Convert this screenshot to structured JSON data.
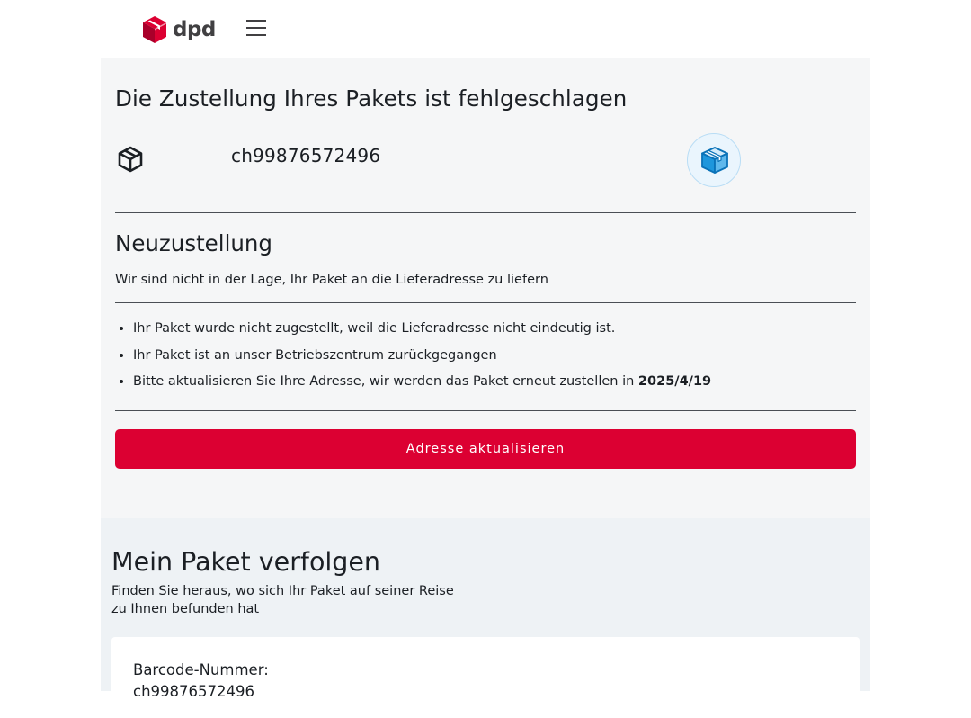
{
  "header": {
    "logo_text": "dpd",
    "menu_icon": "hamburger-icon",
    "brand_color": "#dc0032"
  },
  "notice": {
    "title": "Die Zustellung Ihres Pakets ist fehlgeschlagen",
    "parcel_icon": "parcel-outline-icon",
    "tracking_number": "ch99876572496",
    "badge_icon": "box-icon",
    "section_title": "Neuzustellung",
    "section_subtitle": "Wir sind nicht in der Lage, Ihr Paket an die Lieferadresse zu liefern",
    "bullets": {
      "item_1": "Ihr Paket wurde nicht zugestellt, weil die Lieferadresse nicht eindeutig ist.",
      "item_2": "Ihr Paket ist an unser Betriebszentrum zurückgegangen",
      "item_3_prefix": "Bitte aktualisieren Sie Ihre Adresse, wir werden das Paket erneut zustellen in ",
      "item_3_date": "2025/4/19"
    },
    "button_label": "Adresse aktualisieren",
    "button_color": "#dc0032"
  },
  "tracking": {
    "title": "Mein Paket verfolgen",
    "subtitle": "Finden Sie heraus, wo sich Ihr Paket auf seiner Reise zu Ihnen befunden hat",
    "barcode_label": "Barcode-Nummer:",
    "barcode_value": "ch99876572496"
  }
}
